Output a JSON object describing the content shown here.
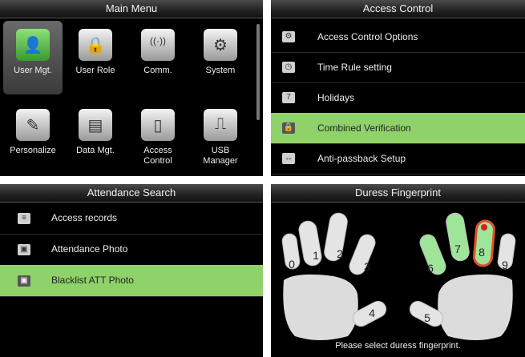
{
  "main_menu": {
    "title": "Main Menu",
    "items": [
      {
        "label": "User Mgt.",
        "icon": "user-mgt-icon",
        "glyph": "👤"
      },
      {
        "label": "User Role",
        "icon": "user-role-icon",
        "glyph": "🔒"
      },
      {
        "label": "Comm.",
        "icon": "comm-icon",
        "glyph": "((·))"
      },
      {
        "label": "System",
        "icon": "system-gear-icon",
        "glyph": "⚙"
      },
      {
        "label": "Personalize",
        "icon": "personalize-icon",
        "glyph": "✎"
      },
      {
        "label": "Data Mgt.",
        "icon": "data-mgt-icon",
        "glyph": "▤"
      },
      {
        "label": "Access\nControl",
        "icon": "access-control-door-icon",
        "glyph": "▯"
      },
      {
        "label": "USB\nManager",
        "icon": "usb-icon",
        "glyph": "⎍"
      }
    ],
    "selected_index": 0
  },
  "access_control": {
    "title": "Access Control",
    "items": [
      {
        "label": "Access Control Options",
        "icon": "options-icon",
        "glyph": "⚙"
      },
      {
        "label": "Time Rule setting",
        "icon": "clock-icon",
        "glyph": "◷"
      },
      {
        "label": "Holidays",
        "icon": "calendar-icon",
        "glyph": "7"
      },
      {
        "label": "Combined Verification",
        "icon": "lock-icon",
        "glyph": "🔒"
      },
      {
        "label": "Anti-passback Setup",
        "icon": "antipassback-icon",
        "glyph": "↔"
      }
    ],
    "selected_index": 3
  },
  "attendance_search": {
    "title": "Attendance Search",
    "items": [
      {
        "label": "Access records",
        "icon": "records-icon",
        "glyph": "≡"
      },
      {
        "label": "Attendance Photo",
        "icon": "photo-icon",
        "glyph": "▣"
      },
      {
        "label": "Blacklist ATT Photo",
        "icon": "blacklist-photo-icon",
        "glyph": "▣"
      }
    ],
    "selected_index": 2
  },
  "duress_fingerprint": {
    "title": "Duress Fingerprint",
    "fingers": [
      "0",
      "1",
      "2",
      "3",
      "4",
      "5",
      "6",
      "7",
      "8",
      "9"
    ],
    "enrolled": [
      "6",
      "7",
      "8"
    ],
    "selected": "8",
    "prompt": "Please select duress fingerprint."
  },
  "colors": {
    "highlight": "#8fd26a",
    "finger_enrolled": "#9ee59a",
    "finger_selected_border": "#e0502c"
  }
}
